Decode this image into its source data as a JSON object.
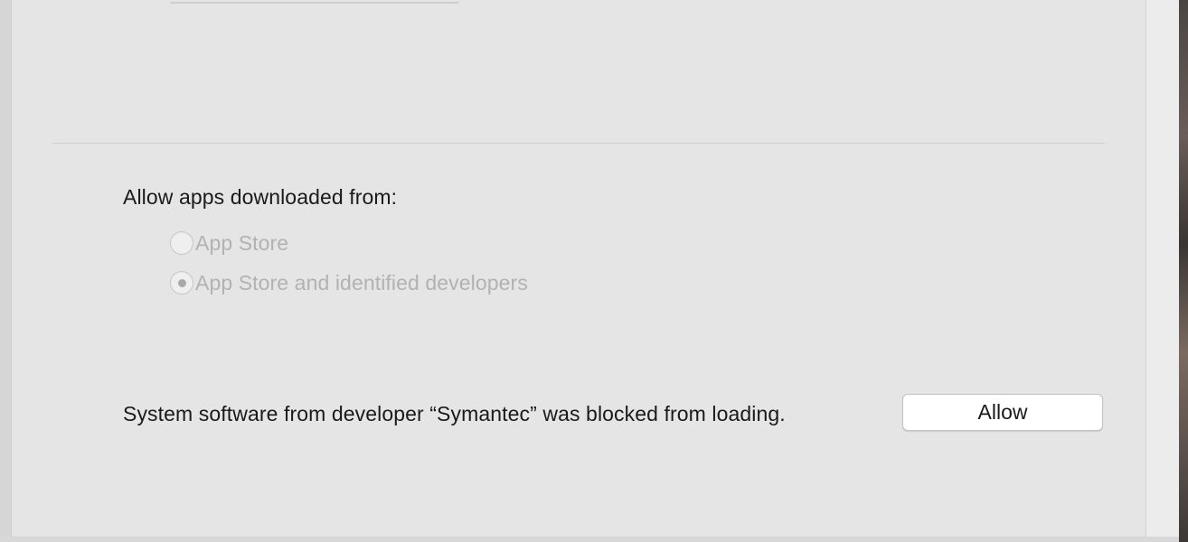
{
  "gatekeeper": {
    "heading": "Allow apps downloaded from:",
    "options": [
      {
        "label": "App Store",
        "selected": false,
        "enabled": false
      },
      {
        "label": "App Store and identified developers",
        "selected": true,
        "enabled": false
      }
    ]
  },
  "blocked_notice": {
    "message": "System software from developer “Symantec” was blocked from loading.",
    "button_label": "Allow"
  },
  "colors": {
    "panel_background": "#e5e5e5",
    "disabled_text": "#b2b2b2",
    "primary_text": "#1a1a1a"
  }
}
